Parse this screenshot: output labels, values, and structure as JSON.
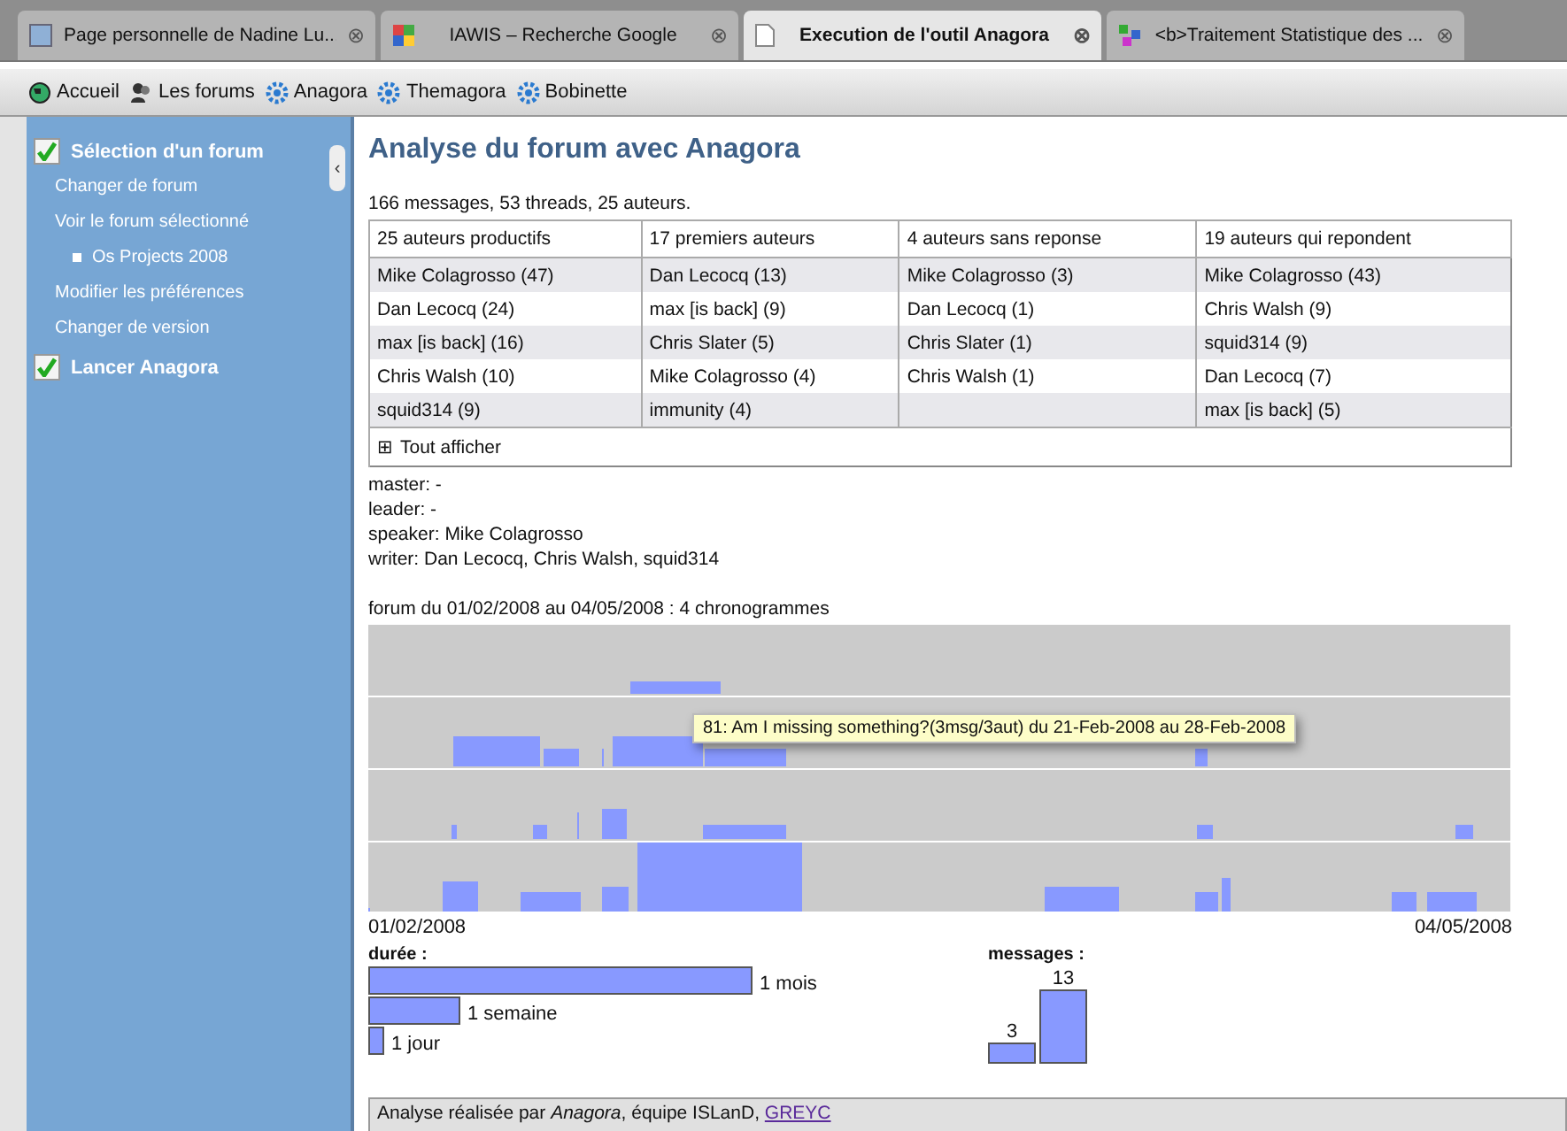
{
  "browser_tabs": [
    {
      "title": "Page personnelle de Nadine Lu...",
      "selected": false
    },
    {
      "title": "IAWIS – Recherche Google",
      "selected": false
    },
    {
      "title": "Execution de l'outil Anagora",
      "selected": true
    },
    {
      "title": "<b>Traitement Statistique des ...",
      "selected": false
    }
  ],
  "tab_close": "⊗",
  "bookmarks": [
    {
      "label": "Accueil"
    },
    {
      "label": "Les forums"
    },
    {
      "label": "Anagora"
    },
    {
      "label": "Themagora"
    },
    {
      "label": "Bobinette"
    }
  ],
  "sidebar": {
    "collapse": "‹",
    "sections": [
      {
        "title": "Sélection d'un forum",
        "checked": true,
        "items": [
          {
            "label": "Changer de forum"
          },
          {
            "label": "Voir le forum sélectionné",
            "children": [
              {
                "label": "Os Projects 2008"
              }
            ]
          },
          {
            "label": "Modifier les préférences"
          },
          {
            "label": "Changer de version"
          }
        ]
      },
      {
        "title": "Lancer Anagora",
        "checked": true
      }
    ]
  },
  "main": {
    "title": "Analyse du forum avec Anagora",
    "summary": "166 messages, 53 threads, 25 auteurs.",
    "table": {
      "columns": [
        "25 auteurs productifs",
        "17 premiers auteurs",
        "4 auteurs sans reponse",
        "19 auteurs qui repondent"
      ],
      "rows": [
        [
          "Mike Colagrosso (47)",
          "Dan Lecocq (13)",
          "Mike Colagrosso (3)",
          "Mike Colagrosso (43)"
        ],
        [
          "Dan Lecocq (24)",
          "max [is back] (9)",
          "Dan Lecocq (1)",
          "Chris Walsh (9)"
        ],
        [
          "max [is back] (16)",
          "Chris Slater (5)",
          "Chris Slater (1)",
          "squid314 (9)"
        ],
        [
          "Chris Walsh (10)",
          "Mike Colagrosso (4)",
          "Chris Walsh (1)",
          "Dan Lecocq (7)"
        ],
        [
          "squid314 (9)",
          "immunity (4)",
          null,
          "max [is back] (5)"
        ]
      ],
      "expand_icon": "⊞",
      "show_all": "Tout afficher"
    },
    "roles": [
      "master: -",
      "leader: -",
      "speaker: Mike Colagrosso",
      "writer: Dan Lecocq, Chris Walsh, squid314"
    ],
    "chrono_title": "forum du 01/02/2008 au 04/05/2008 : 4 chronogrammes",
    "tooltip": "81: Am I missing something?(3msg/3aut) du 21-Feb-2008  au 28-Feb-2008",
    "start_date": "01/02/2008",
    "end_date": "04/05/2008",
    "duration_legend": {
      "title": "durée :",
      "items": [
        {
          "label": "1 mois"
        },
        {
          "label": "1 semaine"
        },
        {
          "label": "1 jour"
        }
      ]
    },
    "messages_legend": {
      "title": "messages :",
      "items": [
        {
          "label": "3"
        },
        {
          "label": "13"
        }
      ]
    },
    "footer": {
      "text": "Analyse réalisée par *Anagora*, équipe ISLanD, ",
      "link": "GREYC"
    }
  }
}
